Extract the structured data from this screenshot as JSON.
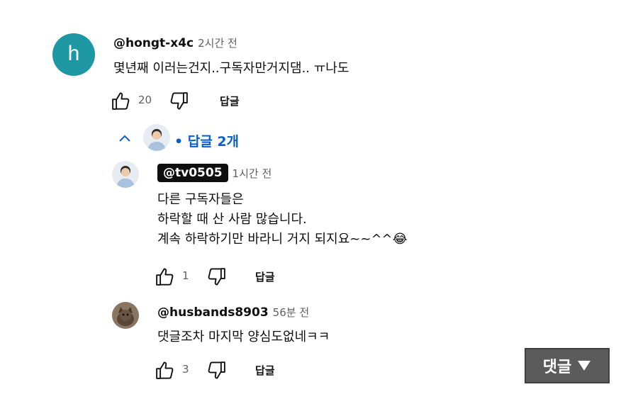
{
  "comment": {
    "avatar_letter": "h",
    "author": "@hongt-x4c",
    "time": "2시간 전",
    "text": "몇년째 이러는건지..구독자만거지댐.. ㅠ나도",
    "likes": "20",
    "reply_label": "답글"
  },
  "replies_toggle": {
    "label": "• 답글 2개"
  },
  "replies": [
    {
      "author": "@tv0505",
      "time": "1시간 전",
      "text": "다른 구독자들은\n하락할 때 산 사람 많습니다.\n계속 하락하기만 바라니 거지 되지요~~^^",
      "emoji": "😂",
      "likes": "1",
      "reply_label": "답글"
    },
    {
      "author": "@husbands8903",
      "time": "56분 전",
      "text": "댓글조차 마지막 양심도없네ㅋㅋ",
      "likes": "3",
      "reply_label": "답글"
    }
  ],
  "floating_button": {
    "label": "댓글",
    "icon": "triangle-down-icon"
  },
  "colors": {
    "avatar_main": "#1c97a3",
    "link_blue": "#065fd4",
    "floating_bg": "#5b5b5b"
  }
}
